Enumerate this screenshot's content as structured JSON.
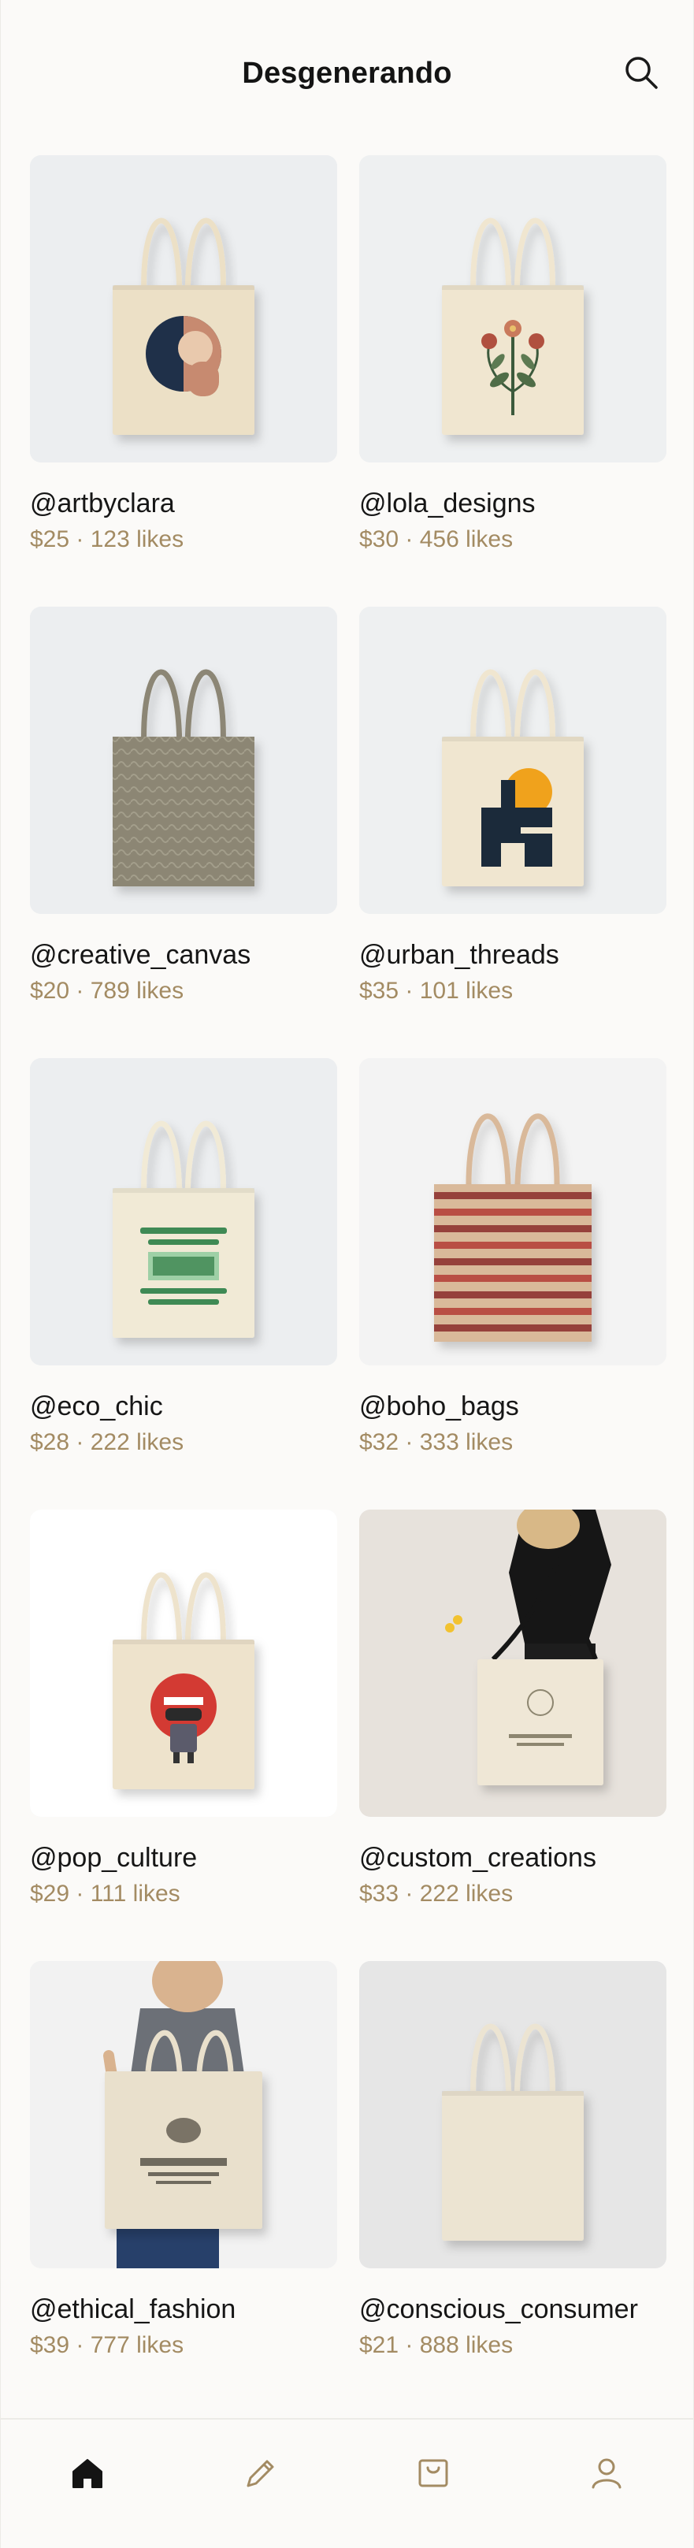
{
  "app": {
    "title": "Desgenerando"
  },
  "header": {
    "search_icon": "search-icon"
  },
  "products": [
    {
      "handle": "@artbyclara",
      "meta": "$25 · 123 likes",
      "art": "abstract-circle",
      "bg": "#eceef0",
      "bag": "#ece0c6"
    },
    {
      "handle": "@lola_designs",
      "meta": "$30 · 456 likes",
      "art": "botanical",
      "bg": "#eef0f1",
      "bag": "#f0e6d0"
    },
    {
      "handle": "@creative_canvas",
      "meta": "$20 · 789 likes",
      "art": "textured",
      "bg": "#eceef0",
      "bag": "#8c8674"
    },
    {
      "handle": "@urban_threads",
      "meta": "$35 · 101 likes",
      "art": "geometric-sun",
      "bg": "#eef0f1",
      "bag": "#f0e6d0"
    },
    {
      "handle": "@eco_chic",
      "meta": "$28 · 222 likes",
      "art": "eco-text",
      "bg": "#eceef0",
      "bag": "#f1ead6"
    },
    {
      "handle": "@boho_bags",
      "meta": "$32 · 333 likes",
      "art": "boho-stripes",
      "bg": "#f3f3f3",
      "bag": "#d9b99a"
    },
    {
      "handle": "@pop_culture",
      "meta": "$29 · 111 likes",
      "art": "pop-character",
      "bg": "#ffffff",
      "bag": "#eee3cc"
    },
    {
      "handle": "@custom_creations",
      "meta": "$33 · 222 likes",
      "art": "model-shoulder",
      "bg": "#e7e2dc",
      "bag": "#efe7d6"
    },
    {
      "handle": "@ethical_fashion",
      "meta": "$39 · 777 likes",
      "art": "model-front",
      "bg": "#f2f2f2",
      "bag": "#e9e0cc"
    },
    {
      "handle": "@conscious_consumer",
      "meta": "$21 · 888 likes",
      "art": "plain",
      "bg": "#e6e6e6",
      "bag": "#ece4d2"
    }
  ],
  "nav": [
    {
      "name": "nav-home",
      "icon": "home-icon",
      "active": true
    },
    {
      "name": "nav-create",
      "icon": "pencil-icon",
      "active": false
    },
    {
      "name": "nav-shop",
      "icon": "bag-icon",
      "active": false
    },
    {
      "name": "nav-profile",
      "icon": "user-icon",
      "active": false
    }
  ],
  "colors": {
    "accent": "#a38b63",
    "text": "#161616",
    "background": "#fbfaf8"
  }
}
